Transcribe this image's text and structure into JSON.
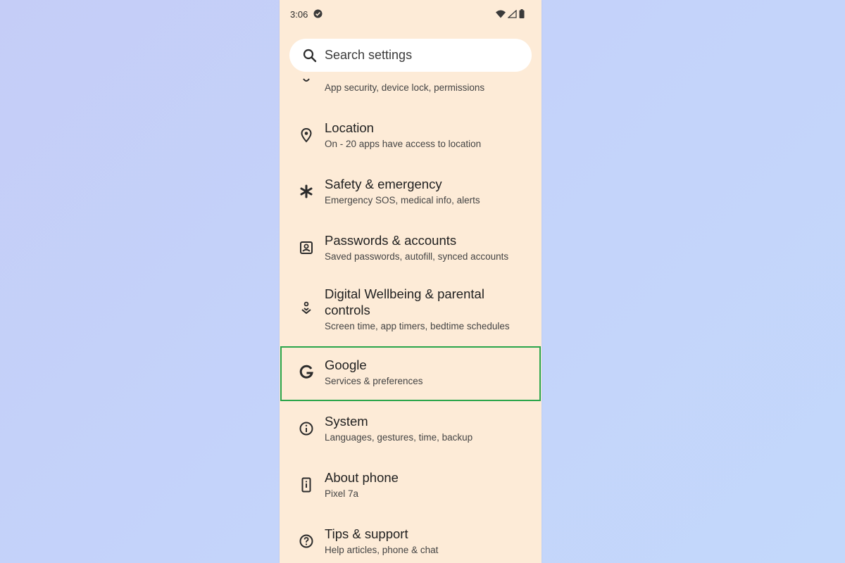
{
  "status_bar": {
    "time": "3:06",
    "icons": [
      "check-circle-icon",
      "wifi-icon",
      "signal-icon",
      "battery-icon"
    ]
  },
  "search": {
    "placeholder": "Search settings",
    "icon": "search-icon"
  },
  "settings": [
    {
      "icon": "shield-icon",
      "title": "",
      "subtitle": "App security, device lock, permissions"
    },
    {
      "icon": "location-pin-icon",
      "title": "Location",
      "subtitle": "On - 20 apps have access to location"
    },
    {
      "icon": "asterisk-icon",
      "title": "Safety & emergency",
      "subtitle": "Emergency SOS, medical info, alerts"
    },
    {
      "icon": "account-box-icon",
      "title": "Passwords & accounts",
      "subtitle": "Saved passwords, autofill, synced accounts"
    },
    {
      "icon": "wellbeing-icon",
      "title": "Digital Wellbeing & parental controls",
      "subtitle": "Screen time, app timers, bedtime schedules"
    },
    {
      "icon": "google-g-icon",
      "title": "Google",
      "subtitle": "Services & preferences",
      "highlighted": true
    },
    {
      "icon": "info-icon",
      "title": "System",
      "subtitle": "Languages, gestures, time, backup"
    },
    {
      "icon": "phone-info-icon",
      "title": "About phone",
      "subtitle": "Pixel 7a"
    },
    {
      "icon": "help-icon",
      "title": "Tips & support",
      "subtitle": "Help articles, phone & chat"
    }
  ],
  "colors": {
    "background": "#c4d3fa",
    "panel": "#fdebd7",
    "highlight_border": "#2aa54a"
  }
}
